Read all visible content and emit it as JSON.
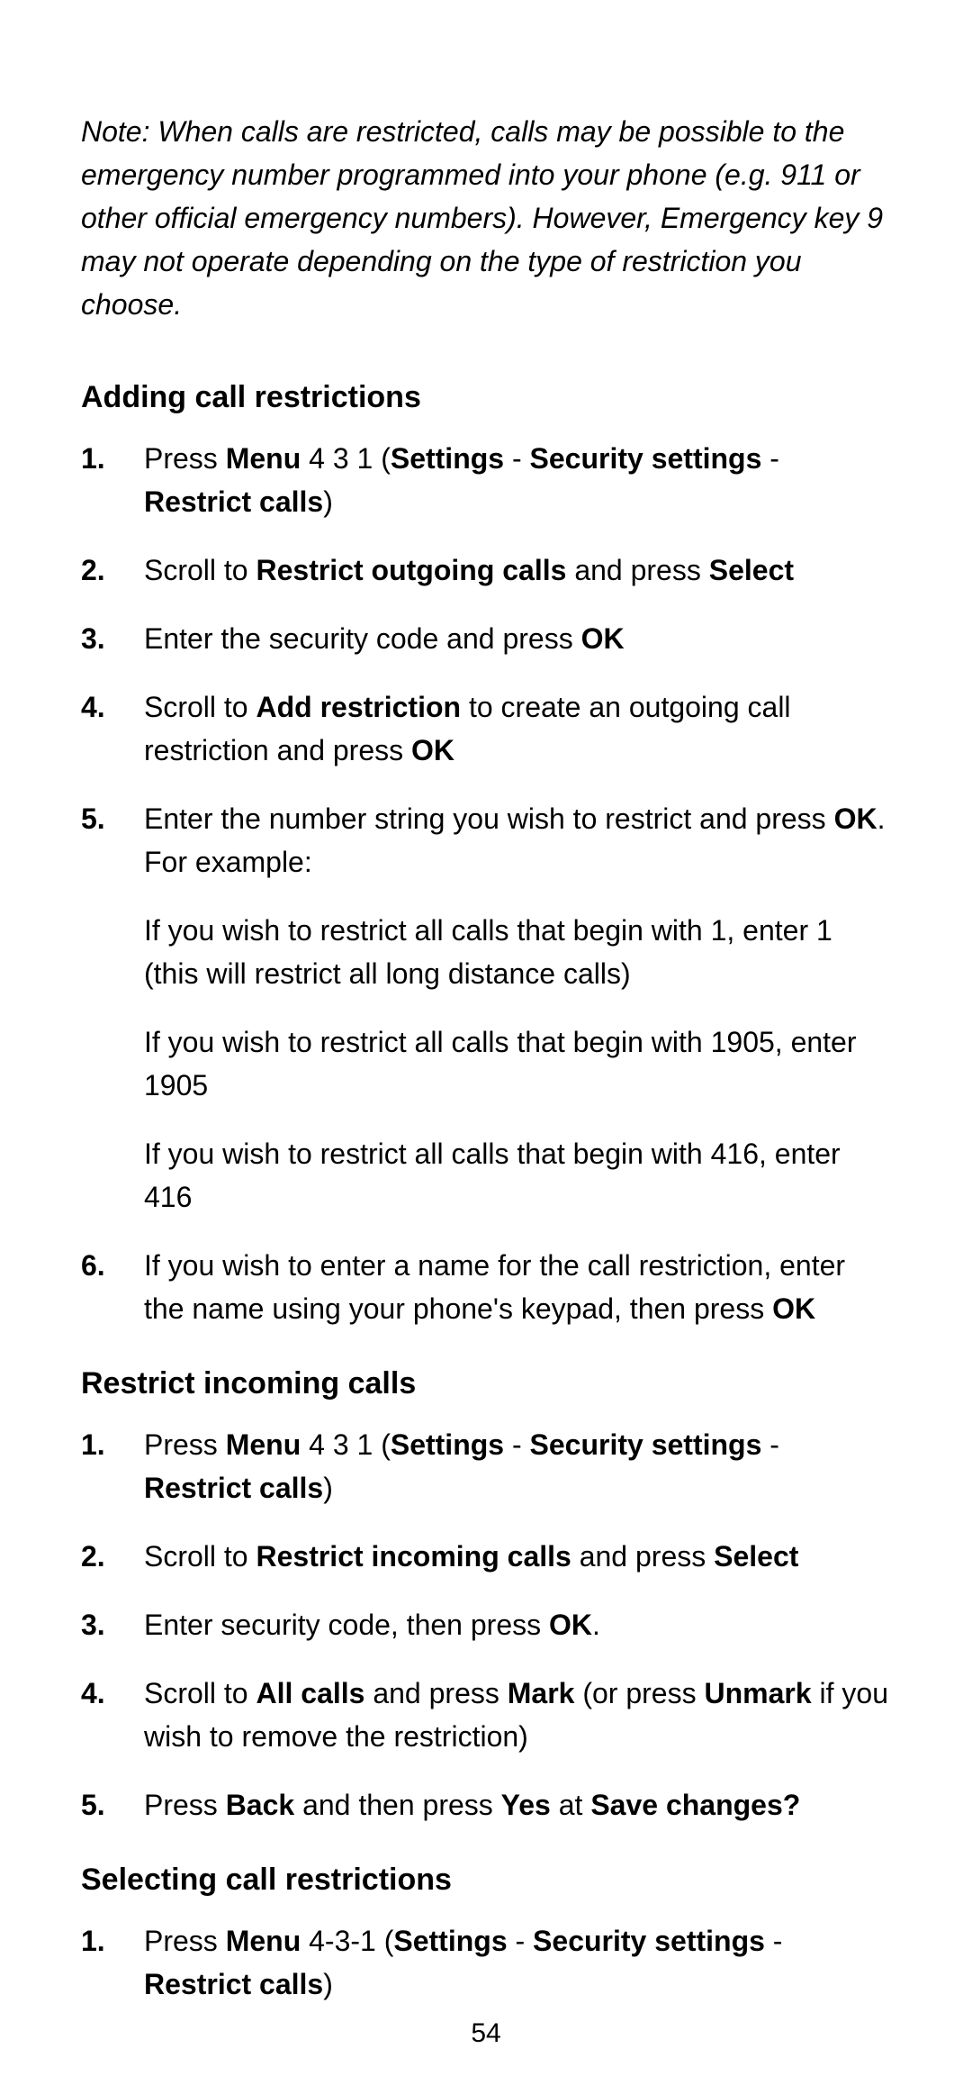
{
  "note": "Note: When calls are restricted, calls may be possible to the emergency number programmed into your phone (e.g. 911 or other official emergency numbers). However, Emergency key 9 may not operate depending on the type of restriction you choose.",
  "section1": {
    "title": "Adding call restrictions",
    "s1": {
      "a": "Press ",
      "b": "Menu",
      "c": " 4 3 1 (",
      "d": "Settings",
      "e": " - ",
      "f": "Security settings",
      "g": " - ",
      "h": "Restrict calls",
      "i": ")"
    },
    "s2": {
      "a": "Scroll to ",
      "b": "Restrict outgoing calls",
      "c": " and press ",
      "d": "Select"
    },
    "s3": {
      "a": "Enter the security code and press ",
      "b": "OK"
    },
    "s4": {
      "a": "Scroll to ",
      "b": "Add restriction",
      "c": " to create an outgoing call restriction and press ",
      "d": "OK"
    },
    "s5": {
      "a": "Enter the number string you wish to restrict and press ",
      "b": "OK",
      "c": ". For example:",
      "sub1": "If you wish to restrict all calls that begin with 1, enter 1 (this will restrict all long distance calls)",
      "sub2": "If you wish to restrict all calls that begin with 1905, enter 1905",
      "sub3": "If you wish to restrict all calls that begin with 416, enter 416"
    },
    "s6": {
      "a": "If you wish to enter a name for the call restriction, enter the name using your phone's keypad, then press ",
      "b": "OK"
    }
  },
  "section2": {
    "title": "Restrict incoming calls",
    "s1": {
      "a": "Press ",
      "b": "Menu",
      "c": " 4 3 1 (",
      "d": "Settings",
      "e": " - ",
      "f": "Security settings",
      "g": " - ",
      "h": "Restrict calls",
      "i": ")"
    },
    "s2": {
      "a": "Scroll to ",
      "b": "Restrict incoming calls",
      "c": " and press ",
      "d": "Select"
    },
    "s3": {
      "a": "Enter security code, then press ",
      "b": "OK",
      "c": "."
    },
    "s4": {
      "a": "Scroll to ",
      "b": "All calls",
      "c": " and press ",
      "d": "Mark",
      "e": " (or press ",
      "f": "Unmark",
      "g": " if you wish to remove the restriction)"
    },
    "s5": {
      "a": "Press ",
      "b": "Back",
      "c": " and then press ",
      "d": "Yes",
      "e": " at ",
      "f": "Save changes?"
    }
  },
  "section3": {
    "title": "Selecting call restrictions",
    "s1": {
      "a": "Press ",
      "b": "Menu",
      "c": " 4-3-1 (",
      "d": "Settings",
      "e": " - ",
      "f": "Security settings",
      "g": " - ",
      "h": "Restrict calls",
      "i": ")"
    }
  },
  "pageNumber": "54"
}
